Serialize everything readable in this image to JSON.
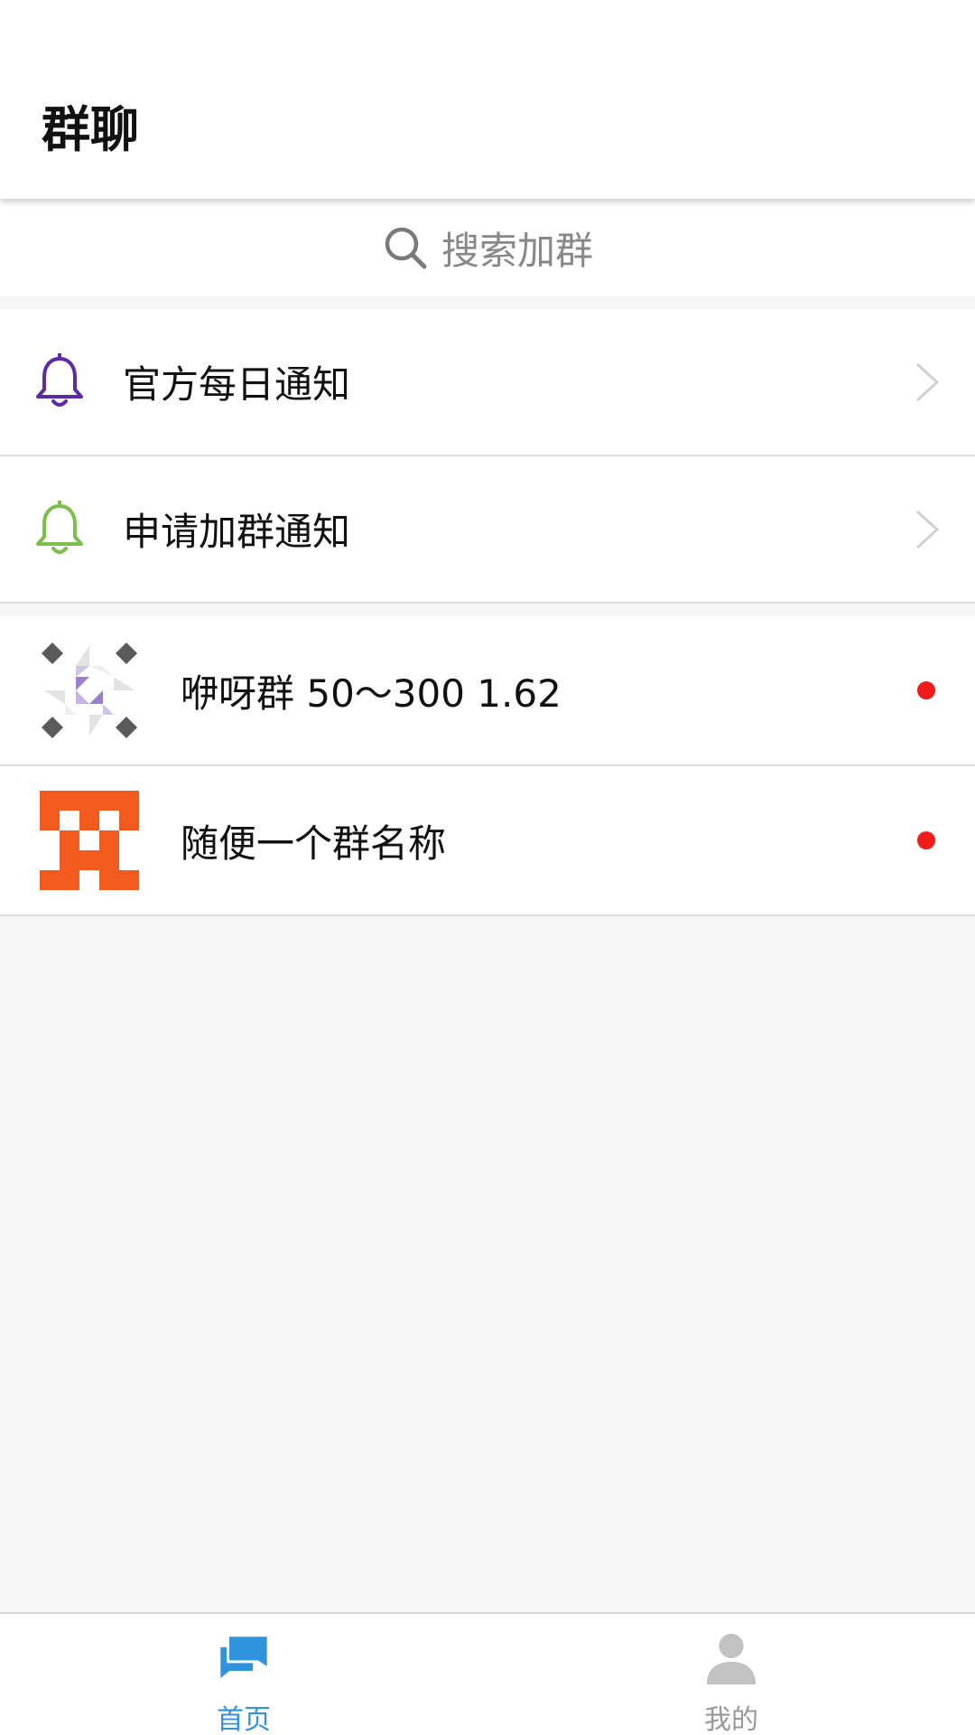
{
  "header": {
    "title": "群聊"
  },
  "search": {
    "placeholder": "搜索加群",
    "icon": "search-icon"
  },
  "notices": [
    {
      "label": "官方每日通知",
      "icon": "bell-icon",
      "color": "#5b2ca6"
    },
    {
      "label": "申请加群通知",
      "icon": "bell-icon",
      "color": "#7cc04b"
    }
  ],
  "groups": [
    {
      "name": "咿呀群 50～300 1.62",
      "unread": true,
      "avatar": "pinwheel-identicon"
    },
    {
      "name": "随便一个群名称",
      "unread": true,
      "avatar": "orange-checker-identicon"
    }
  ],
  "nav": [
    {
      "label": "首页",
      "icon": "chat-icon",
      "active": true,
      "color": "#2f93de"
    },
    {
      "label": "我的",
      "icon": "person-icon",
      "active": false,
      "color": "#c2c2c2"
    }
  ],
  "colors": {
    "accent": "#2f93de",
    "unread": "#f21b1b"
  }
}
